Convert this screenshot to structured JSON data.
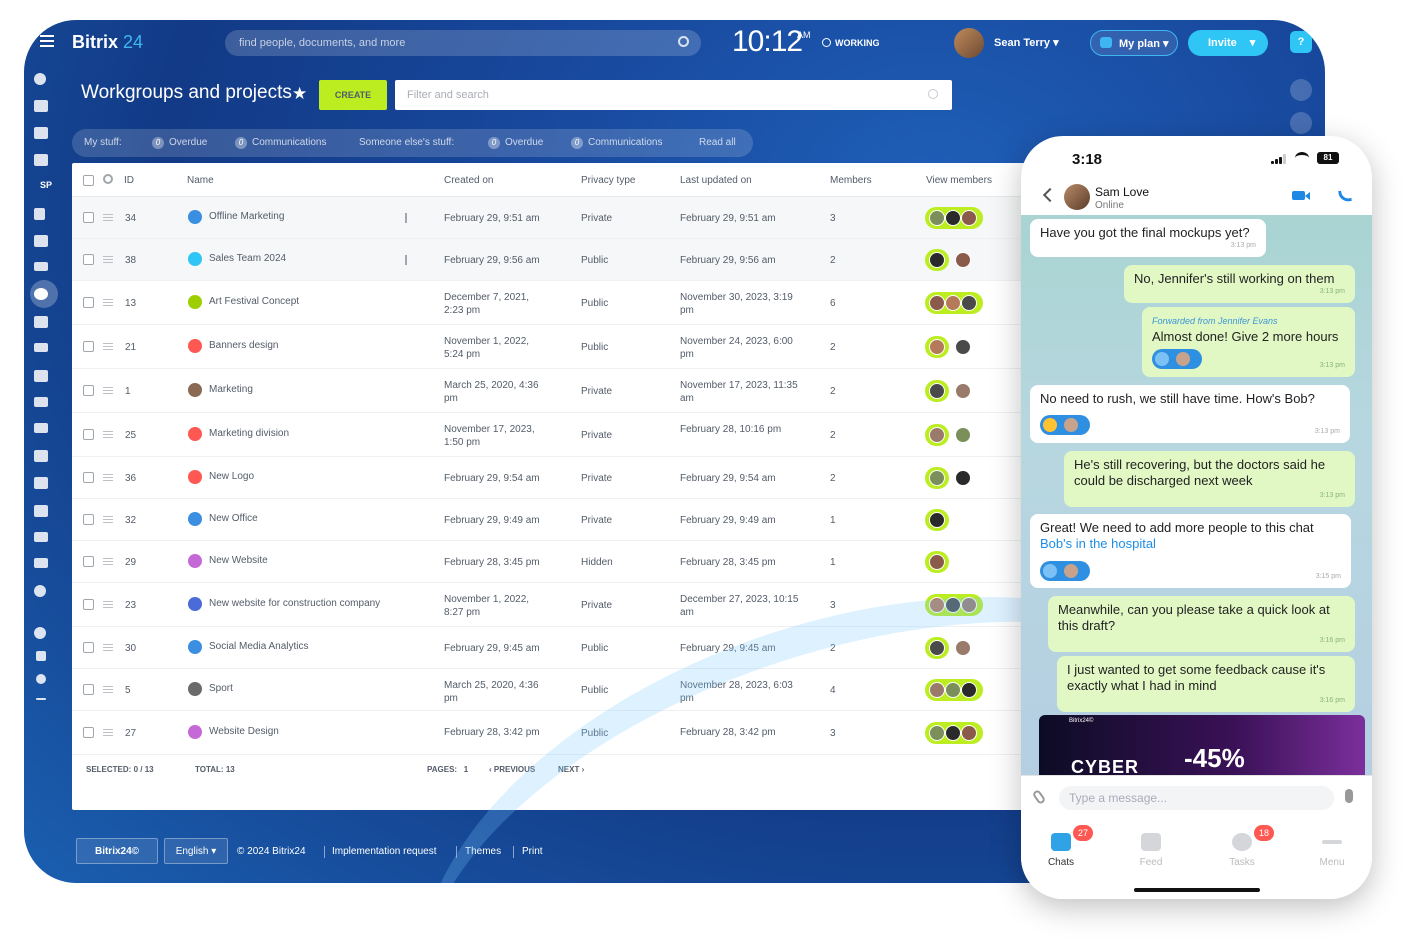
{
  "app": {
    "brand": "Bitrix",
    "brand_num": "24",
    "search_placeholder": "find people, documents, and more",
    "clock": "10:12",
    "ampm": "AM",
    "working": "WORKING",
    "user": "Sean Terry",
    "myplan": "My plan",
    "invite": "Invite",
    "help": "?",
    "rail_sp": "SP"
  },
  "page": {
    "title": "Workgroups and projects",
    "create": "CREATE",
    "filter_placeholder": "Filter and search"
  },
  "counters": {
    "my_stuff": "My stuff:",
    "overdue1": "Overdue",
    "comm1": "Communications",
    "someone": "Someone else's stuff:",
    "overdue2": "Overdue",
    "comm2": "Communications",
    "read_all": "Read all",
    "zero": "0"
  },
  "grid": {
    "headers": {
      "id": "ID",
      "name": "Name",
      "created": "Created on",
      "privacy": "Privacy type",
      "updated": "Last updated on",
      "members": "Members",
      "view": "View members"
    },
    "rows": [
      {
        "id": "34",
        "name": "Offline Marketing",
        "created1": "February 29, 9:51 am",
        "created2": "",
        "privacy": "Private",
        "updated1": "February 29, 9:51 am",
        "updated2": "",
        "members": "3",
        "icon_color": "#3a8fe0",
        "pinned": true,
        "av": 3
      },
      {
        "id": "38",
        "name": "Sales Team 2024",
        "created1": "February 29, 9:56 am",
        "created2": "",
        "privacy": "Public",
        "updated1": "February 29, 9:56 am",
        "updated2": "",
        "members": "2",
        "icon_color": "#2fc6f6",
        "pinned": true,
        "av": 2
      },
      {
        "id": "13",
        "name": "Art Festival Concept",
        "created1": "December 7, 2021,",
        "created2": "2:23 pm",
        "privacy": "Public",
        "updated1": "November 30, 2023, 3:19",
        "updated2": "pm",
        "members": "6",
        "icon_color": "#9dcf00",
        "pinned": false,
        "av": 3
      },
      {
        "id": "21",
        "name": "Banners design",
        "created1": "November 1, 2022,",
        "created2": "5:24 pm",
        "privacy": "Public",
        "updated1": "November 24, 2023, 6:00",
        "updated2": "pm",
        "members": "2",
        "icon_color": "#ff5752",
        "pinned": false,
        "av": 2
      },
      {
        "id": "1",
        "name": "Marketing",
        "created1": "March 25, 2020, 4:36",
        "created2": "pm",
        "privacy": "Private",
        "updated1": "November 17, 2023, 11:35",
        "updated2": "am",
        "members": "2",
        "icon_color": "#8a6a55",
        "pinned": false,
        "av": 2
      },
      {
        "id": "25",
        "name": "Marketing division",
        "created1": "November 17, 2023,",
        "created2": "1:50 pm",
        "privacy": "Private",
        "updated1": "February 28, 10:16 pm",
        "updated2": "",
        "members": "2",
        "icon_color": "#ff5752",
        "pinned": false,
        "av": 2
      },
      {
        "id": "36",
        "name": "New Logo",
        "created1": "February 29, 9:54 am",
        "created2": "",
        "privacy": "Private",
        "updated1": "February 29, 9:54 am",
        "updated2": "",
        "members": "2",
        "icon_color": "#ff5752",
        "pinned": false,
        "av": 2
      },
      {
        "id": "32",
        "name": "New Office",
        "created1": "February 29, 9:49 am",
        "created2": "",
        "privacy": "Private",
        "updated1": "February 29, 9:49 am",
        "updated2": "",
        "members": "1",
        "icon_color": "#3a8fe0",
        "pinned": false,
        "av": 1
      },
      {
        "id": "29",
        "name": "New Website",
        "created1": "February 28, 3:45 pm",
        "created2": "",
        "privacy": "Hidden",
        "updated1": "February 28, 3:45 pm",
        "updated2": "",
        "members": "1",
        "icon_color": "#c569d6",
        "pinned": false,
        "av": 1
      },
      {
        "id": "23",
        "name": "New website for construction company",
        "created1": "November 1, 2022,",
        "created2": "8:27 pm",
        "privacy": "Private",
        "updated1": "December 27, 2023, 10:15",
        "updated2": "am",
        "members": "3",
        "icon_color": "#4a6bd8",
        "pinned": false,
        "av": 3
      },
      {
        "id": "30",
        "name": "Social Media Analytics",
        "created1": "February 29, 9:45 am",
        "created2": "",
        "privacy": "Public",
        "updated1": "February 29, 9:45 am",
        "updated2": "",
        "members": "2",
        "icon_color": "#3a8fe0",
        "pinned": false,
        "av": 2
      },
      {
        "id": "5",
        "name": "Sport",
        "created1": "March 25, 2020, 4:36",
        "created2": "pm",
        "privacy": "Public",
        "updated1": "November 28, 2023, 6:03",
        "updated2": "pm",
        "members": "4",
        "icon_color": "#6b6b6b",
        "pinned": false,
        "av": 3
      },
      {
        "id": "27",
        "name": "Website Design",
        "created1": "February 28, 3:42 pm",
        "created2": "",
        "privacy": "Public",
        "updated1": "February 28, 3:42 pm",
        "updated2": "",
        "members": "3",
        "icon_color": "#c569d6",
        "pinned": false,
        "av": 3
      }
    ],
    "footer": {
      "selected_label": "SELECTED:",
      "selected": "0 / 13",
      "total_label": "TOTAL:",
      "total": "13",
      "pages_label": "PAGES:",
      "page": "1",
      "previous": "PREVIOUS",
      "next": "NEXT"
    }
  },
  "footer": {
    "brand": "Bitrix24©",
    "lang": "English",
    "copyright": "© 2024 Bitrix24",
    "impl": "Implementation request",
    "themes": "Themes",
    "print": "Print"
  },
  "phone": {
    "time": "3:18",
    "battery": "81",
    "contact": "Sam Love",
    "status": "Online",
    "messages": {
      "m1": "Have you got the final mockups yet?",
      "m1_time": "3:13 pm",
      "m2": "No, Jennifer's still working on them",
      "m2_time": "3:13 pm",
      "m3_fwd": "Forwarded from Jennifer Evans",
      "m3": "Almost done! Give 2 more hours",
      "m3_time": "3:13 pm",
      "m4": "No need to rush, we still have time. How's Bob?",
      "m4_time": "3:13 pm",
      "m5": "He's still recovering, but the doctors said he could be discharged next week",
      "m5_time": "3:13 pm",
      "m6": "Great! We need to add more people to this chat",
      "m6_link": "Bob's in the hospital",
      "m6_time": "3:15 pm",
      "m7": "Meanwhile, can you please take a quick look at this draft?",
      "m7_time": "3:16 pm",
      "m8": "I just wanted to get some feedback cause it's exactly what I had in mind",
      "m8_time": "3:16 pm"
    },
    "banner": {
      "brand": "Bitrix24©",
      "title": "CYBER",
      "pct": "-45%"
    },
    "input_placeholder": "Type a message...",
    "tabs": {
      "chats": "Chats",
      "chats_badge": "27",
      "feed": "Feed",
      "tasks": "Tasks",
      "tasks_badge": "18",
      "menu": "Menu"
    }
  }
}
